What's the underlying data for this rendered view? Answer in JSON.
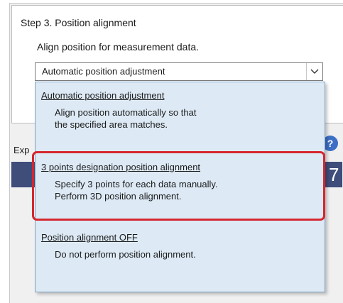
{
  "step": {
    "title": "Step 3. Position alignment",
    "description": "Align position for measurement data."
  },
  "select": {
    "value": "Automatic position adjustment",
    "arrow_icon": "chevron-down-icon"
  },
  "background": {
    "exp_label": "Exp",
    "help_icon": "?",
    "bar_glyph": "7",
    "bar_color": "#3e4d7a"
  },
  "dropdown": {
    "options": [
      {
        "title": "Automatic position adjustment",
        "desc_line1": "Align position automatically so that",
        "desc_line2": "the specified area matches."
      },
      {
        "title": "3 points designation position alignment",
        "desc_line1": "Specify 3 points for each data manually.",
        "desc_line2": "Perform 3D position alignment."
      },
      {
        "title": "Position alignment OFF",
        "desc_line1": "Do not perform position alignment.",
        "desc_line2": ""
      }
    ]
  },
  "colors": {
    "highlight": "#d6262e",
    "dropdown_bg": "#ddeaf5",
    "dropdown_border": "#7ea3c6"
  }
}
